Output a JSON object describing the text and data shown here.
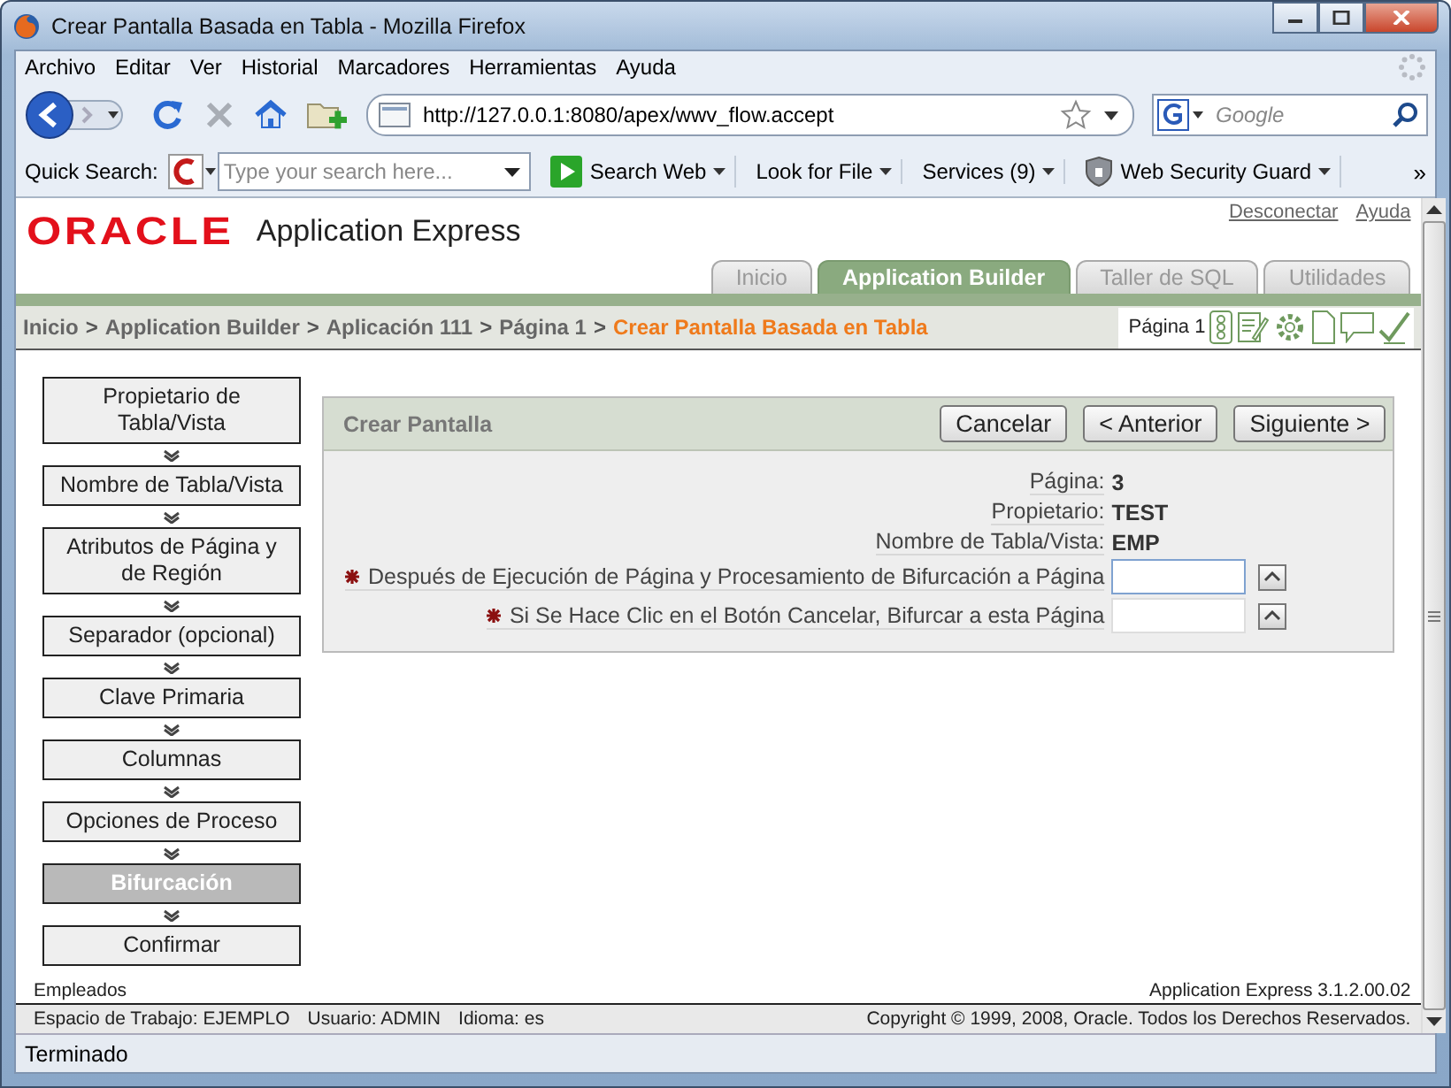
{
  "window": {
    "title": "Crear Pantalla Basada en Tabla - Mozilla Firefox"
  },
  "menu": [
    "Archivo",
    "Editar",
    "Ver",
    "Historial",
    "Marcadores",
    "Herramientas",
    "Ayuda"
  ],
  "navigation": {
    "url": "http://127.0.0.1:8080/apex/wwv_flow.accept",
    "search_placeholder": "Google"
  },
  "toolbar": {
    "label": "Quick Search:",
    "search_placeholder": "Type your search here...",
    "overflow": "»",
    "buttons": [
      {
        "label": "Search Web",
        "kind": "play"
      },
      {
        "label": "Look for File",
        "kind": "plain"
      },
      {
        "label": "Services (9)",
        "kind": "plain"
      },
      {
        "label": "Web Security Guard",
        "kind": "shield"
      }
    ]
  },
  "header": {
    "logo": "ORACLE",
    "product": "Application Express",
    "links": [
      "Desconectar",
      "Ayuda"
    ]
  },
  "tabs": [
    {
      "label": "Inicio",
      "selected": false
    },
    {
      "label": "Application Builder",
      "selected": true
    },
    {
      "label": "Taller de SQL",
      "selected": false
    },
    {
      "label": "Utilidades",
      "selected": false
    }
  ],
  "breadcrumb": {
    "items": [
      "Inicio",
      "Application Builder",
      "Aplicación 111",
      "Página 1"
    ],
    "separator": ">",
    "current": "Crear Pantalla Basada en Tabla",
    "page_label": "Página 1"
  },
  "steps": [
    {
      "label": "Propietario de Tabla/Vista",
      "selected": false
    },
    {
      "label": "Nombre de Tabla/Vista",
      "selected": false
    },
    {
      "label": "Atributos de Página y de Región",
      "selected": false
    },
    {
      "label": "Separador (opcional)",
      "selected": false
    },
    {
      "label": "Clave Primaria",
      "selected": false
    },
    {
      "label": "Columnas",
      "selected": false
    },
    {
      "label": "Opciones de Proceso",
      "selected": false
    },
    {
      "label": "Bifurcación",
      "selected": true
    },
    {
      "label": "Confirmar",
      "selected": false
    }
  ],
  "region": {
    "title": "Crear Pantalla",
    "buttons": [
      "Cancelar",
      "< Anterior",
      "Siguiente >"
    ],
    "info": [
      {
        "label": "Página:",
        "value": "3"
      },
      {
        "label": "Propietario:",
        "value": "TEST"
      },
      {
        "label": "Nombre de Tabla/Vista:",
        "value": "EMP"
      }
    ],
    "fields": [
      {
        "label": "Después de Ejecución de Página y Procesamiento de Bifurcación a Página",
        "required": true,
        "focused": true
      },
      {
        "label": "Si Se Hace Clic en el Botón Cancelar, Bifurcar a esta Página",
        "required": true,
        "focused": false
      }
    ]
  },
  "footer": {
    "page_name": "Empleados",
    "version": "Application Express 3.1.2.00.02",
    "workspace": [
      "Espacio de Trabajo: EJEMPLO",
      "Usuario: ADMIN",
      "Idioma: es"
    ],
    "copyright": "Copyright © 1999, 2008, Oracle. Todos los Derechos Reservados."
  },
  "status_bar": {
    "text": "Terminado"
  }
}
